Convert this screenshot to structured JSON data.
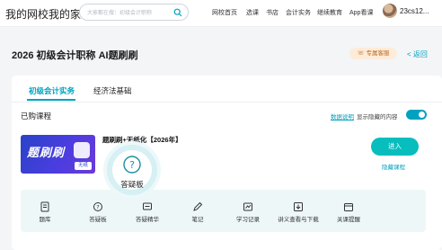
{
  "header": {
    "logo": "我的网校我的家",
    "search_placeholder": "大家都在搜：初级会计职称",
    "nav": [
      "网校首页",
      "选课",
      "书店",
      "会计实务",
      "继续教育",
      "App看课"
    ],
    "user": "23cs12..."
  },
  "page": {
    "title": "2026 初级会计职称 AI题刷刷",
    "vip_badge": "专属客服",
    "back": "< 返回"
  },
  "tabs": [
    {
      "label": "初级会计实务",
      "active": true
    },
    {
      "label": "经济法基础",
      "active": false
    }
  ],
  "purchased": {
    "label": "已购课程",
    "data_note": "数据说明",
    "show_hidden": "显示隐藏的内容",
    "show_hidden_on": true
  },
  "course": {
    "thumb_text": "题刷刷",
    "thumb_tag": "无纸",
    "title": "题刷刷+无纸化【2026年】",
    "enter": "进入",
    "hide": "隐藏课程"
  },
  "tools": [
    {
      "label": "题库",
      "icon": "question-bank-icon"
    },
    {
      "label": "答疑板",
      "icon": "qa-board-icon"
    },
    {
      "label": "答疑精华",
      "icon": "qa-essence-icon"
    },
    {
      "label": "笔记",
      "icon": "notes-icon"
    },
    {
      "label": "学习记录",
      "icon": "study-record-icon"
    },
    {
      "label": "讲义查看与下载",
      "icon": "handout-download-icon"
    },
    {
      "label": "关课提醒",
      "icon": "close-reminder-icon"
    }
  ],
  "highlight": {
    "label": "答疑板",
    "icon": "qa-board-icon"
  },
  "colors": {
    "accent": "#00a2bf",
    "button": "#08bdbd",
    "vip_bg": "#fdecd9",
    "vip_text": "#c06a24"
  }
}
